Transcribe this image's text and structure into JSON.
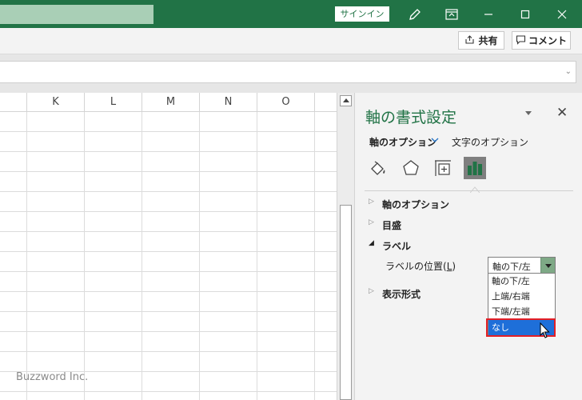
{
  "titlebar": {
    "signin_label": "サインイン",
    "icons": [
      "pen-icon",
      "ribbon-display-icon",
      "minimize-icon",
      "maximize-icon",
      "close-icon"
    ],
    "bg_color": "#217346"
  },
  "ribbon": {
    "share_label": "共有",
    "comment_label": "コメント"
  },
  "grid": {
    "columns": [
      "K",
      "L",
      "M",
      "N",
      "O"
    ]
  },
  "pane": {
    "title": "軸の書式設定",
    "tabs": [
      {
        "label": "軸のオプション",
        "active": true
      },
      {
        "label": "文字のオプション",
        "active": false
      }
    ],
    "format_icons": [
      "fill-line-icon",
      "effects-icon",
      "size-properties-icon",
      "axis-options-icon"
    ],
    "sections": [
      {
        "label": "軸のオプション",
        "expanded": false
      },
      {
        "label": "目盛",
        "expanded": false
      },
      {
        "label": "ラベル",
        "expanded": true
      },
      {
        "label": "表示形式",
        "expanded": false
      }
    ],
    "label_position": {
      "label_prefix": "ラベルの位置(",
      "label_hotkey": "L",
      "label_suffix": ")",
      "value": "軸の下/左",
      "options": [
        "軸の下/左",
        "上端/右端",
        "下端/左端",
        "なし"
      ],
      "highlighted": "なし"
    }
  },
  "watermark": "Buzzword Inc."
}
